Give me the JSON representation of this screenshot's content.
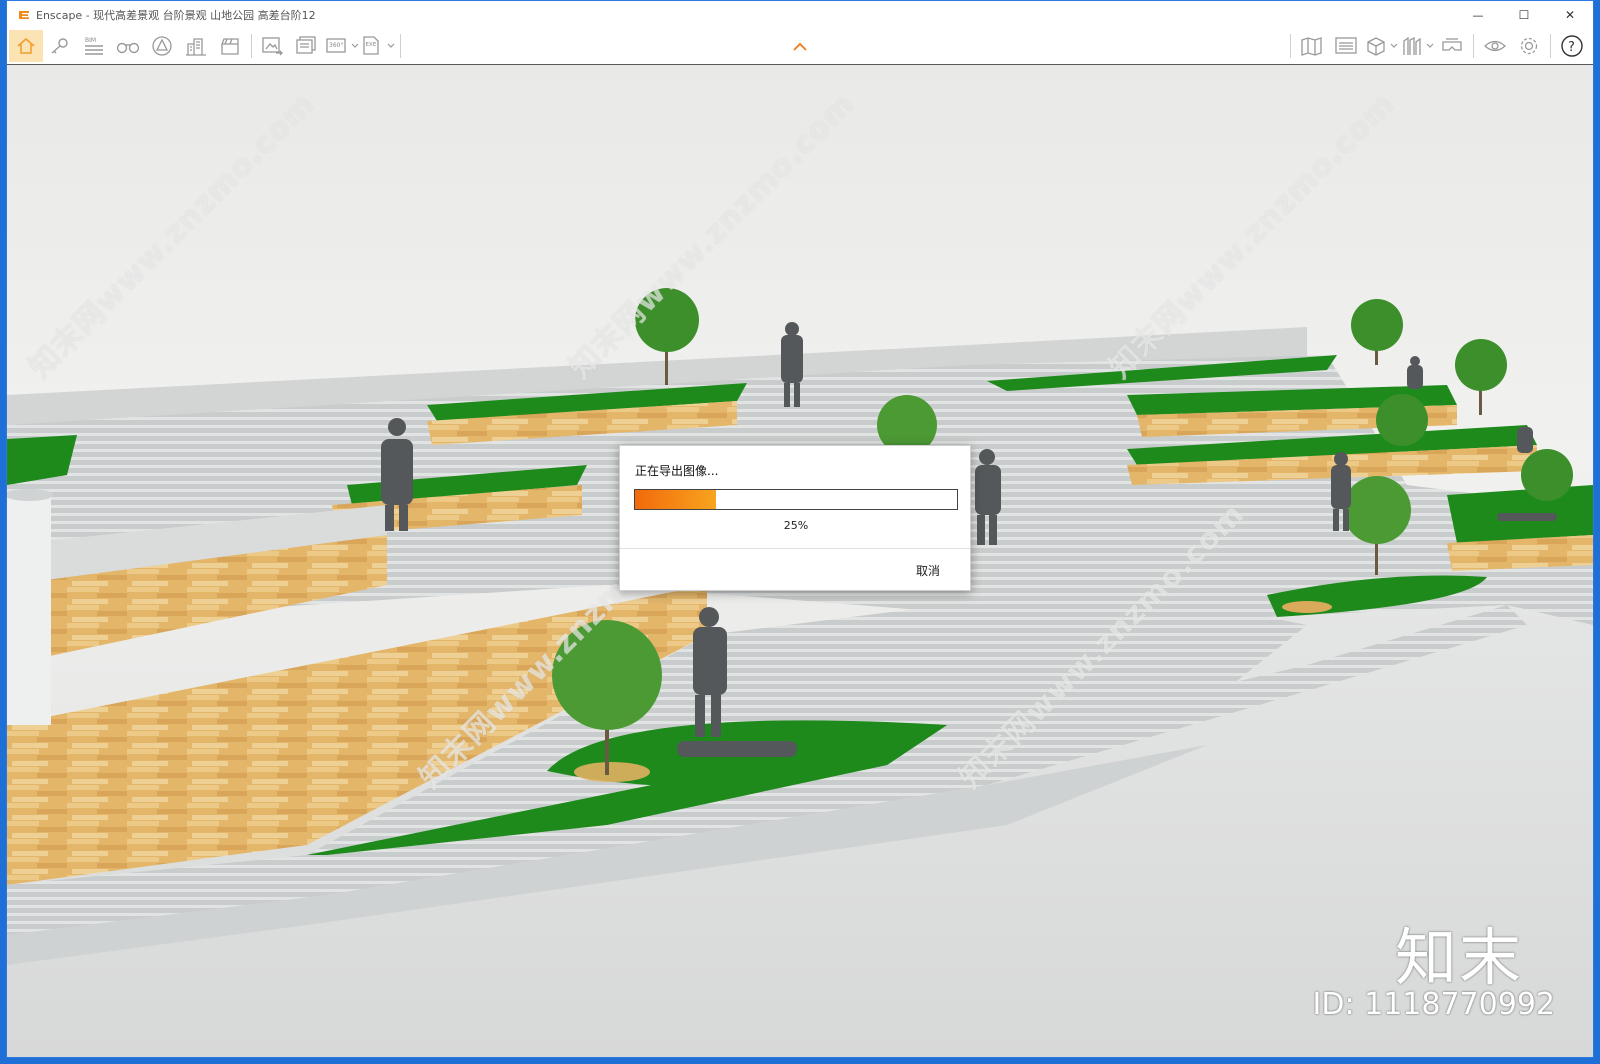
{
  "window": {
    "title": "Enscape - 现代高差景观 台阶景观 山地公园 高差台阶12",
    "controls": {
      "minimize": "—",
      "maximize": "☐",
      "close": "✕"
    }
  },
  "toolbar": {
    "left_icons": [
      "home-icon",
      "key-icon",
      "bim-icon",
      "binoculars-icon",
      "warning-icon",
      "buildings-icon",
      "clapper-icon"
    ],
    "export_icons": [
      "screenshot-icon",
      "batch-render-icon",
      "panorama-360-icon",
      "exe-export-icon"
    ],
    "bim_label": "BIM",
    "pano_label": "360°",
    "exe_label": "EXE",
    "right_icons": [
      "map-icon",
      "views-icon",
      "cube-icon",
      "asset-library-icon",
      "vr-headset-icon",
      "eye-icon",
      "settings-icon",
      "help-icon"
    ],
    "help_label": "?"
  },
  "dialog": {
    "title": "正在导出图像...",
    "progress": 0.25,
    "progress_label": "25%",
    "cancel": "取消"
  },
  "watermark": {
    "diagonal_text": "知末网www.znzmo.com",
    "logo_text": "知末",
    "id_text": "ID: 1118770992"
  },
  "colors": {
    "accent": "#f7a41e",
    "progress_start": "#f26a0c",
    "grass": "#1f8a1c",
    "wood": "#e7b86a",
    "stone": "#cdd0d0"
  }
}
